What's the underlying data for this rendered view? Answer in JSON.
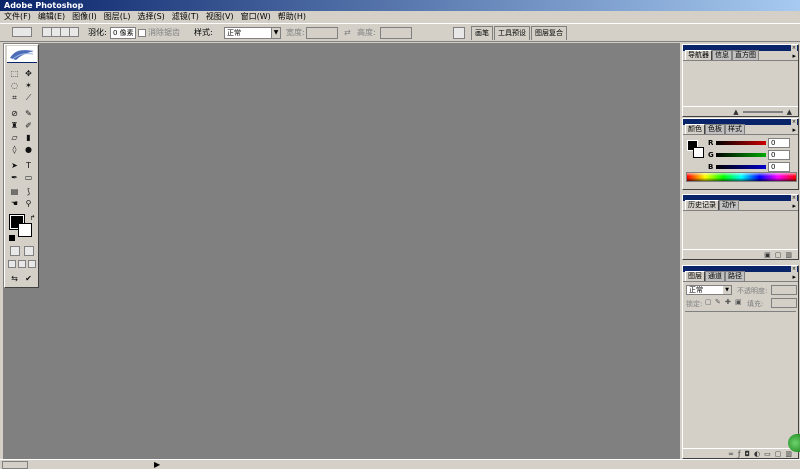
{
  "app": {
    "title": "Adobe Photoshop"
  },
  "menu": [
    "文件(F)",
    "编辑(E)",
    "图像(I)",
    "图层(L)",
    "选择(S)",
    "滤镜(T)",
    "视图(V)",
    "窗口(W)",
    "帮助(H)"
  ],
  "options": {
    "feather_label": "羽化:",
    "feather_value": "0 像素",
    "antialias_label": "消除锯齿",
    "style_label": "样式:",
    "style_value": "正常",
    "width_label": "宽度:",
    "height_label": "高度:"
  },
  "palette_well": {
    "tabs": [
      "画笔",
      "工具预设",
      "图层复合"
    ]
  },
  "navigator": {
    "tabs": [
      "导航器",
      "信息",
      "直方图"
    ]
  },
  "color": {
    "tabs": [
      "颜色",
      "色板",
      "样式"
    ],
    "channels": [
      {
        "label": "R",
        "value": "0",
        "color": "#cc0000"
      },
      {
        "label": "G",
        "value": "0",
        "color": "#00aa00"
      },
      {
        "label": "B",
        "value": "0",
        "color": "#0000cc"
      }
    ]
  },
  "history": {
    "tabs": [
      "历史记录",
      "动作"
    ]
  },
  "layers": {
    "tabs": [
      "图层",
      "通道",
      "路径"
    ],
    "blend_mode": "正常",
    "opacity_label": "不透明度:",
    "lock_label": "锁定:",
    "fill_label": "填充:"
  },
  "icons": {
    "close": "×",
    "menu_arrow": "▸",
    "status_arrow": "▶"
  },
  "colors": {
    "titlebar": "#0a246a",
    "workspace": "#808080",
    "chrome": "#d4d0c8"
  }
}
